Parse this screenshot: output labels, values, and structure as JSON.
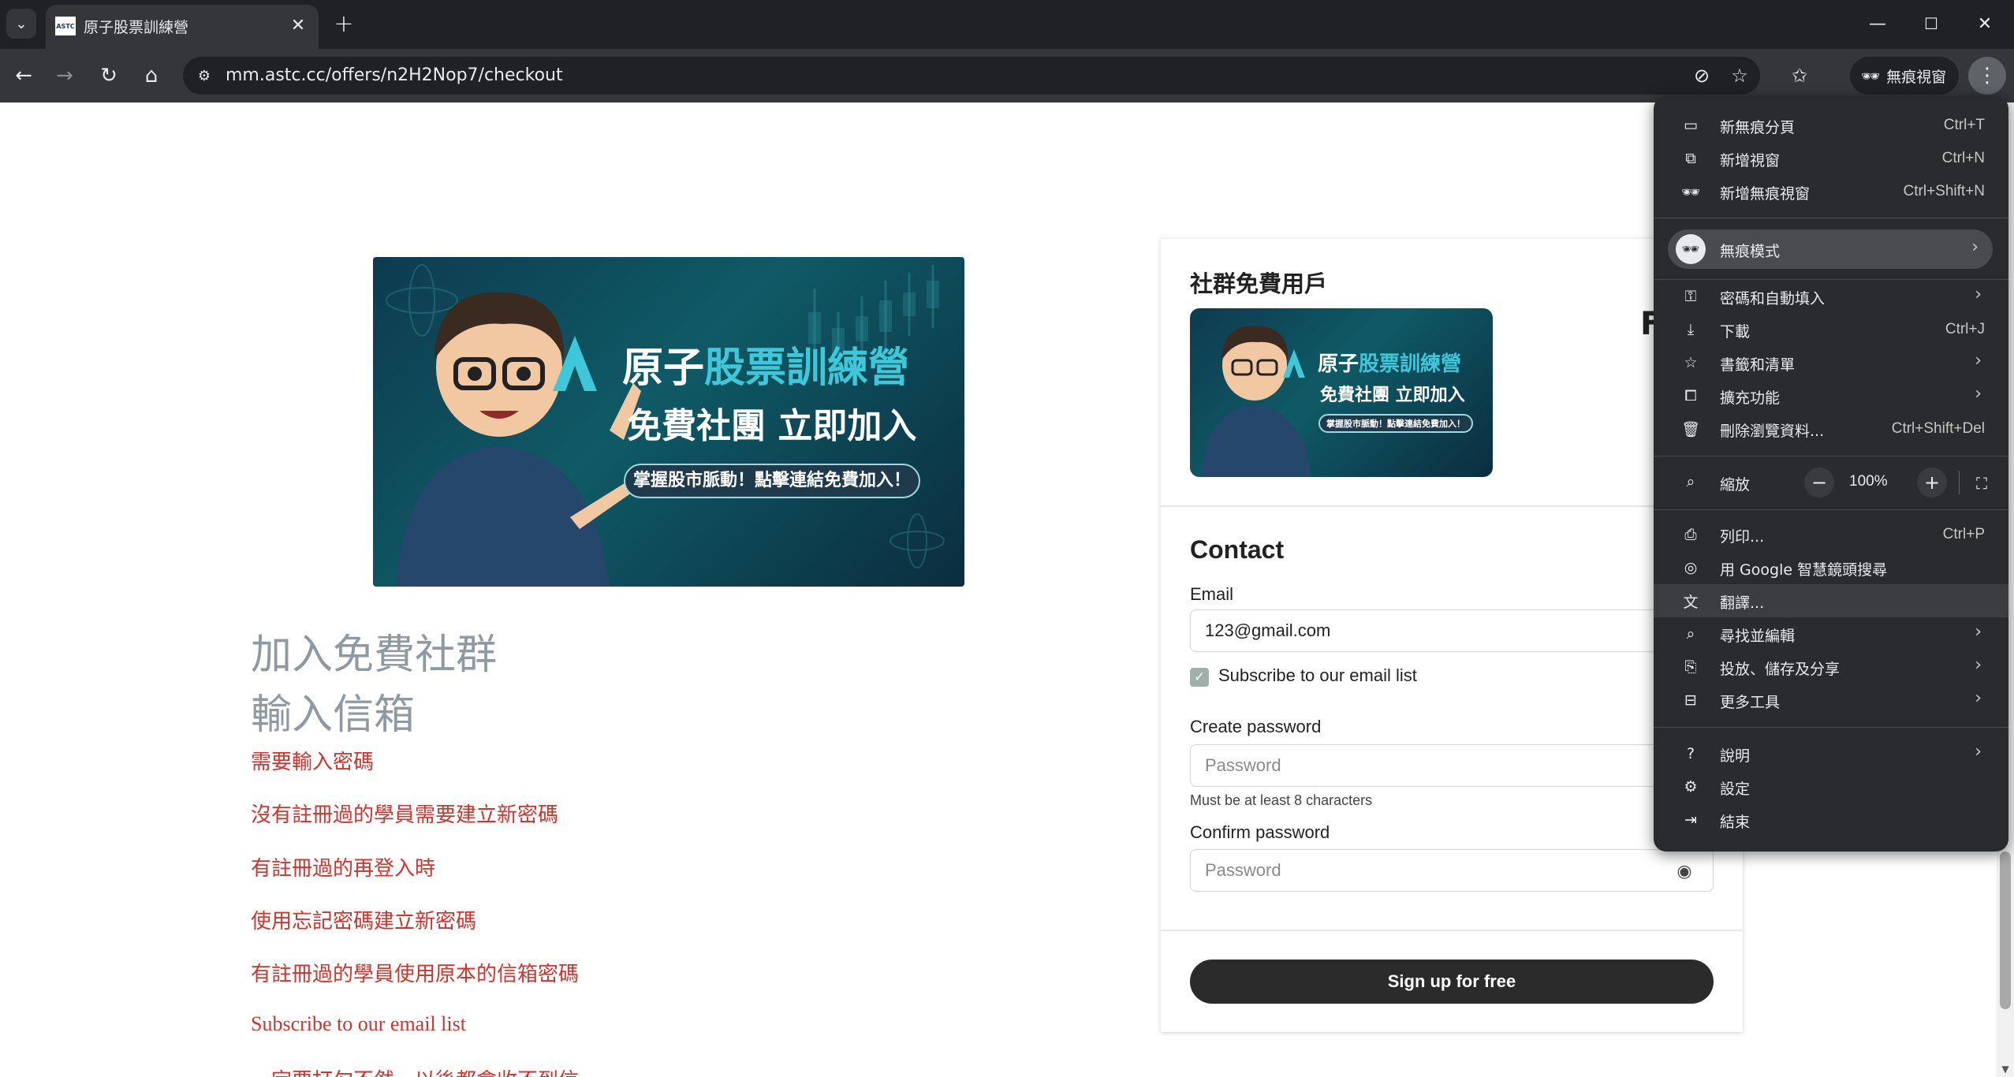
{
  "browser": {
    "tab_title": "原子股票訓練營",
    "favicon_text": "ASTC",
    "url": "mm.astc.cc/offers/n2H2Nop7/checkout",
    "incognito_label": "無痕視窗"
  },
  "banner": {
    "brand": "原子",
    "brand_accent": "股票訓練營",
    "line2": "免費社團 立即加入",
    "pill": "掌握股市脈動！點擊連結免費加入！"
  },
  "left": {
    "heading1": "加入免費社群",
    "heading2": "輸入信箱",
    "lines": [
      "需要輸入密碼",
      "沒有註冊過的學員需要建立新密碼",
      "有註冊過的再登入時",
      "使用忘記密碼建立新密碼",
      "有註冊過的學員使用原本的信箱密碼",
      "Subscribe to our email list",
      "一定要打勾不然，以後都會收不到信"
    ]
  },
  "checkout": {
    "offer_title": "社群免費用戶",
    "partial_heading": "F",
    "contact_heading": "Contact",
    "email_label": "Email",
    "email_value": "123@gmail.com",
    "subscribe_label": "Subscribe to our email list",
    "create_password_label": "Create password",
    "password_placeholder": "Password",
    "password_hint": "Must be at least 8 characters",
    "confirm_password_label": "Confirm password",
    "confirm_placeholder": "Password",
    "submit_label": "Sign up for free"
  },
  "menu": {
    "items": [
      {
        "label": "新無痕分頁",
        "shortcut": "Ctrl+T",
        "icon": "new-tab-icon"
      },
      {
        "label": "新增視窗",
        "shortcut": "Ctrl+N",
        "icon": "new-window-icon"
      },
      {
        "label": "新增無痕視窗",
        "shortcut": "Ctrl+Shift+N",
        "icon": "incognito-icon"
      },
      {
        "label": "無痕模式",
        "shortcut": "",
        "icon": "incognito-icon"
      },
      {
        "label": "密碼和自動填入",
        "shortcut": "",
        "icon": "key-icon"
      },
      {
        "label": "下載",
        "shortcut": "Ctrl+J",
        "icon": "download-icon"
      },
      {
        "label": "書籤和清單",
        "shortcut": "",
        "icon": "star-icon"
      },
      {
        "label": "擴充功能",
        "shortcut": "",
        "icon": "puzzle-icon"
      },
      {
        "label": "刪除瀏覽資料...",
        "shortcut": "Ctrl+Shift+Del",
        "icon": "trash-icon"
      },
      {
        "label": "縮放",
        "shortcut": "",
        "icon": "zoom-icon"
      },
      {
        "label": "列印...",
        "shortcut": "Ctrl+P",
        "icon": "print-icon"
      },
      {
        "label": "用 Google 智慧鏡頭搜尋",
        "shortcut": "",
        "icon": "lens-icon"
      },
      {
        "label": "翻譯...",
        "shortcut": "",
        "icon": "translate-icon"
      },
      {
        "label": "尋找並編輯",
        "shortcut": "",
        "icon": "find-icon"
      },
      {
        "label": "投放、儲存及分享",
        "shortcut": "",
        "icon": "cast-icon"
      },
      {
        "label": "更多工具",
        "shortcut": "",
        "icon": "toolbox-icon"
      },
      {
        "label": "說明",
        "shortcut": "",
        "icon": "help-icon"
      },
      {
        "label": "設定",
        "shortcut": "",
        "icon": "gear-icon"
      },
      {
        "label": "結束",
        "shortcut": "",
        "icon": "exit-icon"
      }
    ],
    "zoom_value": "100%"
  }
}
